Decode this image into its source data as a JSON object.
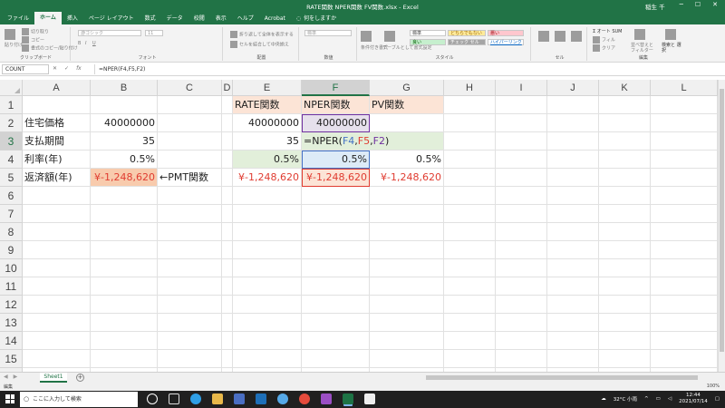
{
  "window": {
    "title": "RATE関数 NPER関数 FV関数.xlsx - Excel",
    "user": "稲生 千"
  },
  "ribbon_tabs": [
    "ファイル",
    "ホーム",
    "挿入",
    "ページ レイアウト",
    "数式",
    "データ",
    "校閲",
    "表示",
    "ヘルプ",
    "Acrobat"
  ],
  "tell_me": "何をしますか",
  "ribbon": {
    "clipboard": {
      "paste": "貼り付け",
      "cut": "切り取り",
      "copy": "コピー",
      "format_painter": "書式のコピー/貼り付け",
      "label": "クリップボード"
    },
    "font": {
      "font_name": "游ゴシック",
      "font_size": "11",
      "label": "フォント"
    },
    "alignment": {
      "wrap": "折り返して全体を表示する",
      "merge": "セルを結合して中央揃え",
      "label": "配置"
    },
    "number": {
      "format": "標準",
      "label": "数値"
    },
    "styles": {
      "conditional": "条件付き書式",
      "table": "テーブルとして書式設定",
      "normal": "標準",
      "neutral": "どちらでもない",
      "bad": "悪い",
      "good": "良い",
      "check": "チェック セル",
      "hyperlink": "ハイパーリンク",
      "label": "スタイル"
    },
    "cells": {
      "label": "セル"
    },
    "editing": {
      "autosum": "オート SUM",
      "fill": "フィル",
      "clear": "クリア",
      "sort": "並べ替えと フィルター",
      "find": "検索と 選択",
      "label": "編集"
    }
  },
  "formula_bar": {
    "name_box": "COUNT",
    "cancel": "✕",
    "enter": "✓",
    "fx": "fx",
    "formula": "=NPER(F4,F5,F2)"
  },
  "columns": [
    "A",
    "B",
    "C",
    "D",
    "E",
    "F",
    "G",
    "H",
    "I",
    "J",
    "K",
    "L"
  ],
  "rows": [
    "1",
    "2",
    "3",
    "4",
    "5",
    "6",
    "7",
    "8",
    "9",
    "10",
    "11",
    "12",
    "13",
    "14",
    "15",
    "16"
  ],
  "cells": {
    "E1": "RATE関数",
    "F1": "NPER関数",
    "G1": "PV関数",
    "A2": "住宅価格",
    "B2": "40000000",
    "E2": "40000000",
    "F2": "40000000",
    "A3": "支払期間",
    "B3": "35",
    "E3": "35",
    "F3_prefix": "=NPER(",
    "F3_ref1": "F4",
    "F3_comma1": ",",
    "F3_ref2": "F5",
    "F3_comma2": ",",
    "F3_ref3": "F2",
    "F3_suffix": ")",
    "A4": "利率(年)",
    "B4": "0.5%",
    "E4": "0.5%",
    "F4": "0.5%",
    "G4": "0.5%",
    "A5": "返済額(年)",
    "B5": "¥-1,248,620",
    "C5": "←PMT関数",
    "E5": "¥-1,248,620",
    "F5": "¥-1,248,620",
    "G5": "¥-1,248,620"
  },
  "sheet_tabs": [
    "Sheet1"
  ],
  "status": {
    "mode": "編集",
    "zoom": "100%"
  },
  "taskbar": {
    "search_placeholder": "ここに入力して検索",
    "weather": "32°C 小雨",
    "time": "12:44",
    "date": "2021/07/14"
  },
  "colors": {
    "excel_green": "#217346",
    "header_fill": "#fce4d6",
    "green_fill": "#e2efda",
    "blue_fill": "#ddebf7",
    "purple_fill": "#e6e0ec",
    "red_text": "#e03c31"
  }
}
